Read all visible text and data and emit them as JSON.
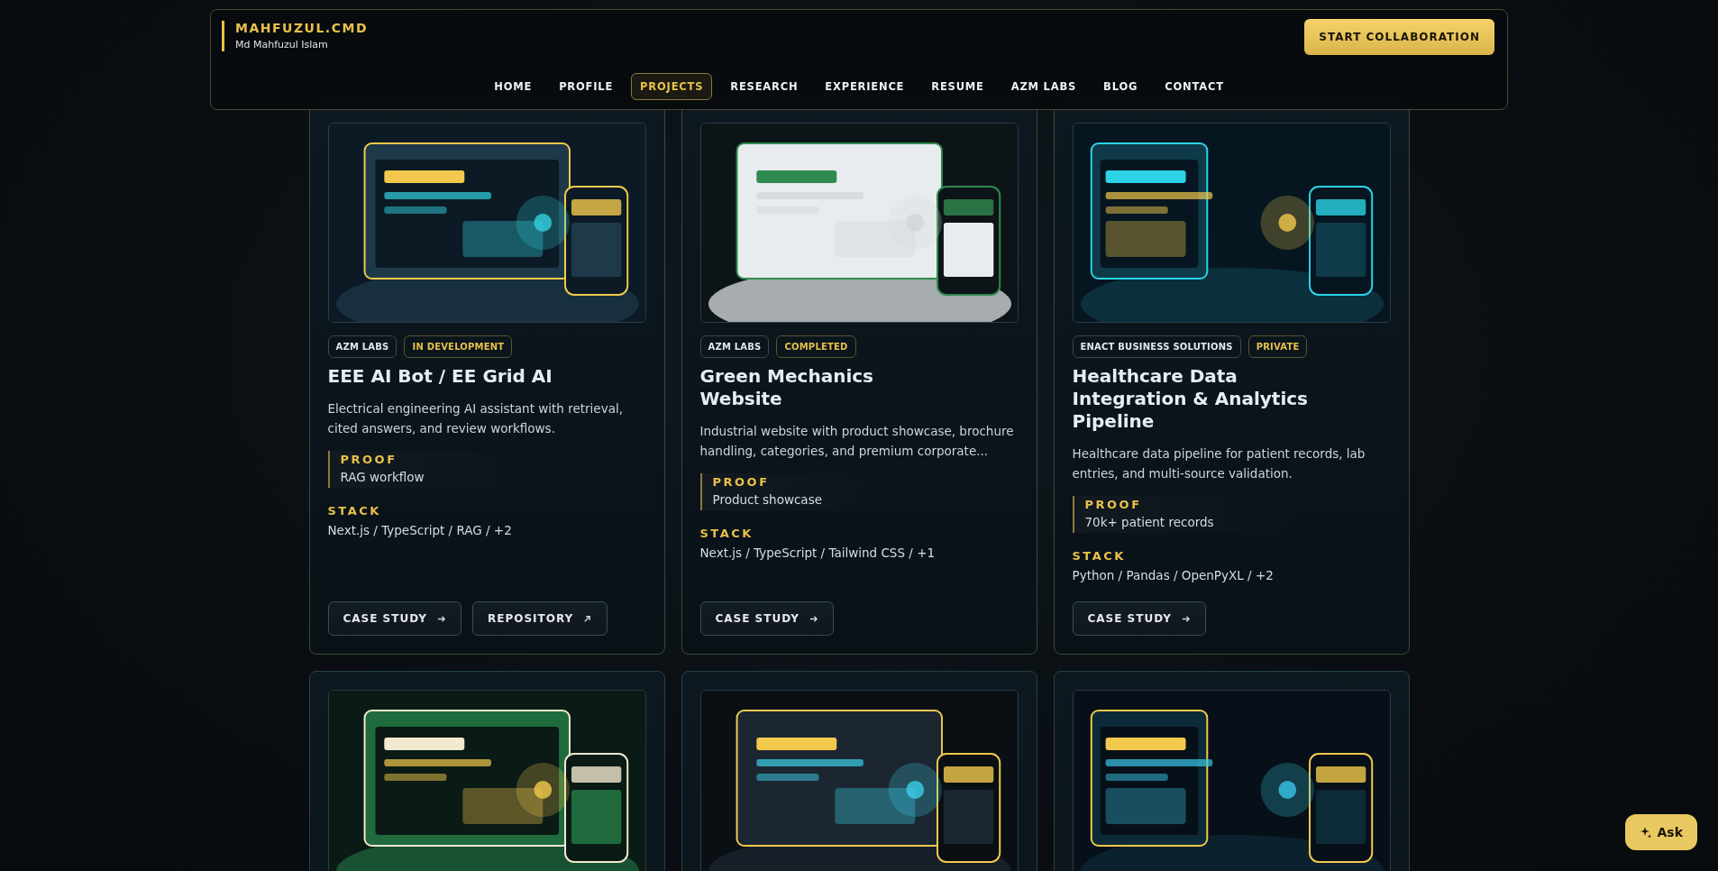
{
  "header": {
    "brand": "MAHFUZUL.CMD",
    "subtitle": "Md Mahfuzul Islam",
    "cta": "START COLLABORATION",
    "nav": [
      {
        "label": "HOME",
        "selected": false
      },
      {
        "label": "PROFILE",
        "selected": false
      },
      {
        "label": "PROJECTS",
        "selected": true
      },
      {
        "label": "RESEARCH",
        "selected": false
      },
      {
        "label": "EXPERIENCE",
        "selected": false
      },
      {
        "label": "RESUME",
        "selected": false
      },
      {
        "label": "AZM LABS",
        "selected": false
      },
      {
        "label": "BLOG",
        "selected": false
      },
      {
        "label": "CONTACT",
        "selected": false
      }
    ]
  },
  "projects": [
    {
      "thumbnail": {
        "kind": "picture"
      },
      "tags": [
        {
          "label": "AZM LABS",
          "kind": "org"
        },
        {
          "label": "IN DEVELOPMENT",
          "kind": "status"
        }
      ],
      "title": "EEE AI Bot / EE Grid AI",
      "description": "Electrical engineering AI assistant with retrieval, cited answers, and review workflows.",
      "proof_label": "PROOF",
      "proof": "RAG workflow",
      "stack_label": "STACK",
      "stack": "Next.js / TypeScript / RAG / +2",
      "buttons": [
        {
          "label": "CASE STUDY",
          "kind": "case"
        },
        {
          "label": "REPOSITORY",
          "kind": "repo"
        }
      ]
    },
    {
      "thumbnail": {
        "kind": "picture"
      },
      "tags": [
        {
          "label": "AZM LABS",
          "kind": "org"
        },
        {
          "label": "COMPLETED",
          "kind": "status"
        }
      ],
      "title": "Green Mechanics Website",
      "description": "Industrial website with product showcase, brochure handling, categories, and premium corporate...",
      "proof_label": "PROOF",
      "proof": "Product showcase",
      "stack_label": "STACK",
      "stack": "Next.js / TypeScript / Tailwind CSS / +1",
      "buttons": [
        {
          "label": "CASE STUDY",
          "kind": "case"
        }
      ]
    },
    {
      "thumbnail": {
        "kind": "picture"
      },
      "tags": [
        {
          "label": "ENACT BUSINESS SOLUTIONS",
          "kind": "org"
        },
        {
          "label": "PRIVATE",
          "kind": "status"
        }
      ],
      "title": "Healthcare Data Integration & Analytics Pipeline",
      "description": "Healthcare data pipeline for patient records, lab entries, and multi-source validation.",
      "proof_label": "PROOF",
      "proof": "70k+ patient records",
      "stack_label": "STACK",
      "stack": "Python / Pandas / OpenPyXL / +2",
      "buttons": [
        {
          "label": "CASE STUDY",
          "kind": "case"
        }
      ]
    },
    {
      "thumbnail": {
        "kind": "picture"
      }
    },
    {
      "thumbnail": {
        "kind": "picture"
      }
    },
    {
      "thumbnail": {
        "kind": "picture"
      }
    }
  ],
  "assistant_button": "Ask"
}
